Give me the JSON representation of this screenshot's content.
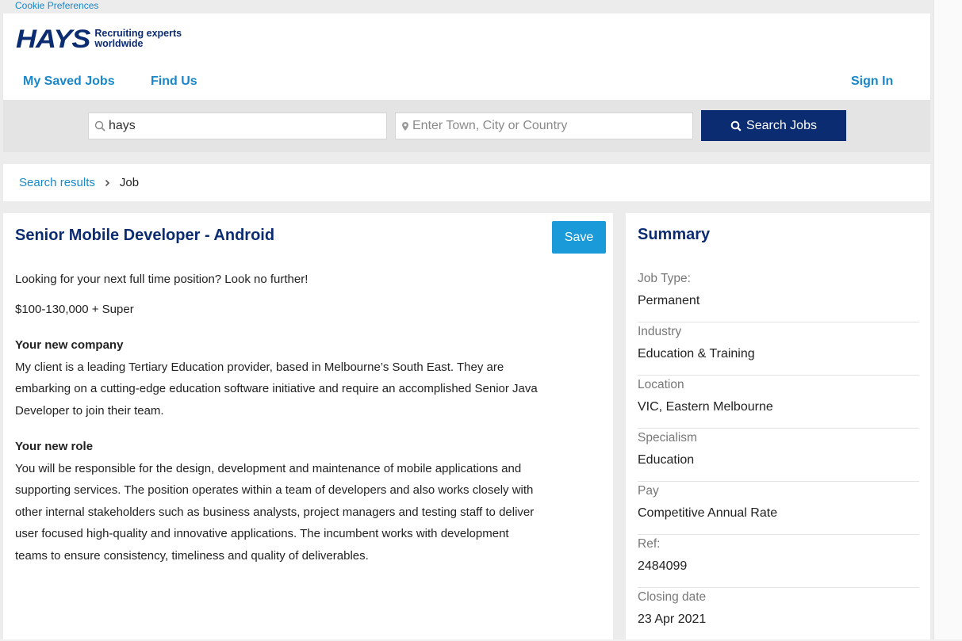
{
  "cookie_link": "Cookie Preferences",
  "logo": {
    "word": "HAYS",
    "tagline_1": "Recruiting experts",
    "tagline_2": "worldwide"
  },
  "nav": {
    "saved_jobs": "My Saved Jobs",
    "find_us": "Find Us",
    "sign_in": "Sign In"
  },
  "search": {
    "keyword_value": "hays",
    "location_placeholder": "Enter Town, City or Country",
    "button_label": "Search Jobs"
  },
  "breadcrumb": {
    "parent": "Search results",
    "current": "Job"
  },
  "job": {
    "title": "Senior Mobile Developer - Android",
    "save_label": "Save",
    "intro": "Looking for your next full time position? Look no further!",
    "salary": "$100-130,000 + Super",
    "sections": [
      {
        "heading": "Your new company",
        "text": "My client is a leading Tertiary Education provider, based in Melbourne’s South East. They are embarking on a cutting-edge education software initiative and require an accomplished Senior Java Developer to join their team."
      },
      {
        "heading": "Your new role",
        "text": "You will be responsible for the design, development and maintenance of mobile applications and supporting services. The position operates within a team of developers and also works closely with other internal stakeholders such as business analysts, project managers and testing staff to deliver user focused high-quality and innovative applications. The incumbent works with development teams to ensure consistency, timeliness and quality of deliverables."
      }
    ]
  },
  "summary": {
    "heading": "Summary",
    "items": [
      {
        "label": "Job Type:",
        "value": "Permanent"
      },
      {
        "label": "Industry",
        "value": "Education & Training"
      },
      {
        "label": "Location",
        "value": "VIC, Eastern Melbourne"
      },
      {
        "label": "Specialism",
        "value": "Education"
      },
      {
        "label": "Pay",
        "value": "Competitive Annual Rate"
      },
      {
        "label": "Ref:",
        "value": "2484099"
      },
      {
        "label": "Closing date",
        "value": "23 Apr 2021"
      }
    ]
  },
  "colors": {
    "brand_navy": "#0c2c72",
    "link_blue": "#1a87c8",
    "save_blue": "#1a9ad8"
  }
}
